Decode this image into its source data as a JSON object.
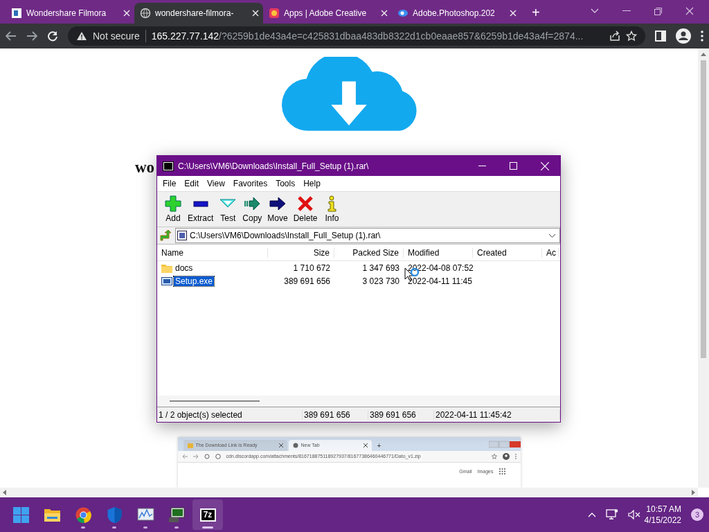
{
  "browser": {
    "tabs": [
      {
        "title": "Wondershare Filmora",
        "kind": "doc",
        "selected": false
      },
      {
        "title": "wondershare-filmora-",
        "kind": "globe",
        "selected": true
      },
      {
        "title": "Apps | Adobe Creative",
        "kind": "adobe",
        "selected": false
      },
      {
        "title": "Adobe.Photoshop.202",
        "kind": "ps",
        "selected": false
      }
    ],
    "new_tab": "+",
    "security": "Not secure",
    "url_host": "165.227.77.142",
    "url_rest": "/?6259b1de43a4e=c425831dbaa483db8322d1cb0eaae857&6259b1de43a4f=2874..."
  },
  "page": {
    "heading": "wo",
    "embedded_screenshot": {
      "tabs": [
        {
          "title": "The Download Link is Ready",
          "selected": false
        },
        {
          "title": "New Tab",
          "selected": true
        }
      ],
      "new_tab": "+",
      "url": "cdn.discordapp.com/attachments/816718875118927937/81677386460446771/Dato_v1.zip",
      "links": [
        "Gmail",
        "Images"
      ]
    }
  },
  "archive_window": {
    "title": "C:\\Users\\VM6\\Downloads\\Install_Full_Setup (1).rar\\",
    "menu": [
      "File",
      "Edit",
      "View",
      "Favorites",
      "Tools",
      "Help"
    ],
    "toolbar": [
      {
        "label": "Add",
        "kind": "add"
      },
      {
        "label": "Extract",
        "kind": "extract"
      },
      {
        "label": "Test",
        "kind": "test"
      },
      {
        "label": "Copy",
        "kind": "copy"
      },
      {
        "label": "Move",
        "kind": "move"
      },
      {
        "label": "Delete",
        "kind": "delete"
      },
      {
        "label": "Info",
        "kind": "info"
      }
    ],
    "path": "C:\\Users\\VM6\\Downloads\\Install_Full_Setup (1).rar\\",
    "columns": [
      "Name",
      "Size",
      "Packed Size",
      "Modified",
      "Created",
      "Ac"
    ],
    "rows": [
      {
        "kind": "folder",
        "name": "docs",
        "size": "1 710 672",
        "packed_size": "1 347 693",
        "modified": "2022-04-08 07:52",
        "selected": false
      },
      {
        "kind": "file",
        "name": "Setup.exe",
        "size": "389 691 656",
        "packed_size": "3 023 730",
        "modified": "2022-04-11 11:45",
        "selected": true
      }
    ],
    "status": [
      "1 / 2 object(s) selected",
      "389 691 656",
      "389 691 656",
      "2022-04-11 11:45:42"
    ]
  },
  "taskbar": {
    "apps": [
      {
        "kind": "start",
        "running": false,
        "selected": false
      },
      {
        "kind": "folder",
        "running": false,
        "selected": false
      },
      {
        "kind": "chrome",
        "running": true,
        "selected": false
      },
      {
        "kind": "shield",
        "running": true,
        "selected": false
      },
      {
        "kind": "monitor",
        "running": true,
        "selected": false
      },
      {
        "kind": "terminal",
        "running": true,
        "selected": false
      },
      {
        "kind": "sevenzip",
        "running": true,
        "selected": true
      }
    ],
    "sevenzip_label": "7z",
    "time": "10:57 AM",
    "date": "4/15/2022",
    "badge": "3"
  }
}
